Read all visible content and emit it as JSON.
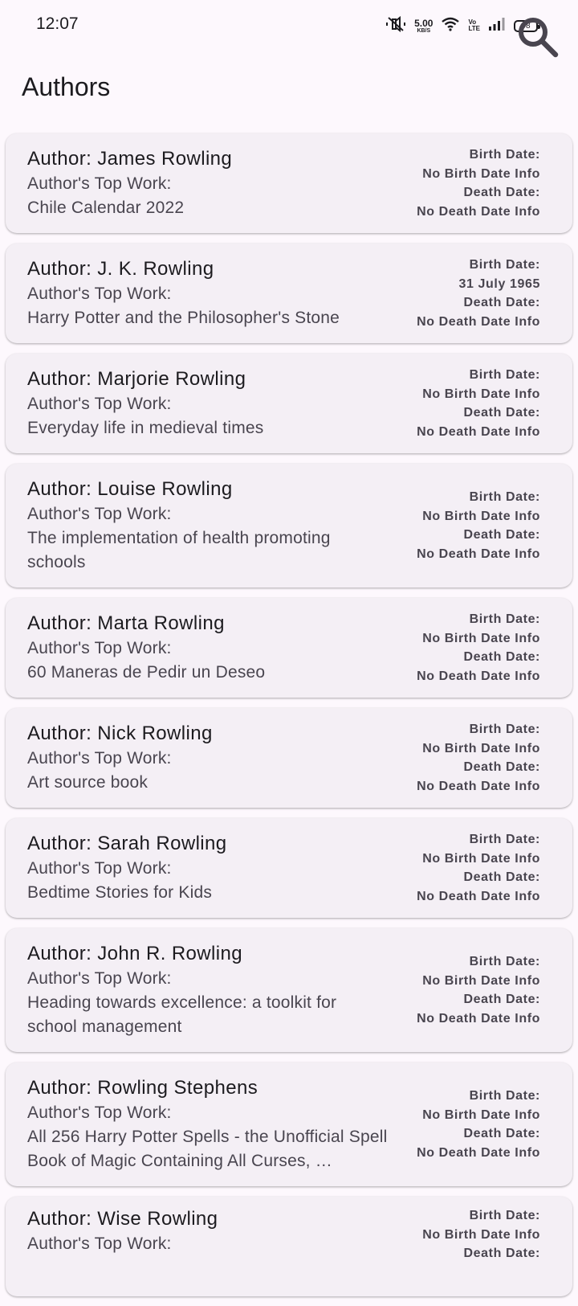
{
  "status": {
    "time": "12:07",
    "net_speed": "5.00",
    "net_unit": "KB/S",
    "volte_top": "Vo",
    "volte_bottom": "LTE",
    "battery": "98"
  },
  "header": {
    "title": "Authors",
    "search_icon": "search-icon"
  },
  "labels": {
    "top_work": "Author's Top Work:",
    "birth": "Birth Date:",
    "death": "Death Date:"
  },
  "authors": [
    {
      "name": "Author: James Rowling",
      "top_work": "Chile Calendar 2022",
      "birth": "No Birth Date Info",
      "death": "No Death Date Info"
    },
    {
      "name": "Author: J. K. Rowling",
      "top_work": "Harry Potter and the Philosopher's Stone",
      "birth": "31 July 1965",
      "death": "No Death Date Info"
    },
    {
      "name": "Author: Marjorie Rowling",
      "top_work": "Everyday life in medieval times",
      "birth": "No Birth Date Info",
      "death": "No Death Date Info"
    },
    {
      "name": "Author: Louise Rowling",
      "top_work": "The implementation of health promoting schools",
      "birth": "No Birth Date Info",
      "death": "No Death Date Info"
    },
    {
      "name": "Author: Marta Rowling",
      "top_work": "60 Maneras de Pedir un Deseo",
      "birth": "No Birth Date Info",
      "death": "No Death Date Info"
    },
    {
      "name": "Author: Nick Rowling",
      "top_work": "Art source book",
      "birth": "No Birth Date Info",
      "death": "No Death Date Info"
    },
    {
      "name": "Author: Sarah Rowling",
      "top_work": "Bedtime Stories for Kids",
      "birth": "No Birth Date Info",
      "death": "No Death Date Info"
    },
    {
      "name": "Author: John R. Rowling",
      "top_work": "Heading towards excellence: a toolkit for school management",
      "birth": "No Birth Date Info",
      "death": "No Death Date Info"
    },
    {
      "name": "Author: Rowling Stephens",
      "top_work": "All 256 Harry Potter Spells - the Unofficial Spell Book of Magic Containing All Curses, …",
      "birth": "No Birth Date Info",
      "death": "No Death Date Info"
    },
    {
      "name": "Author: Wise Rowling",
      "top_work": "",
      "birth": "No Birth Date Info",
      "death": ""
    }
  ]
}
